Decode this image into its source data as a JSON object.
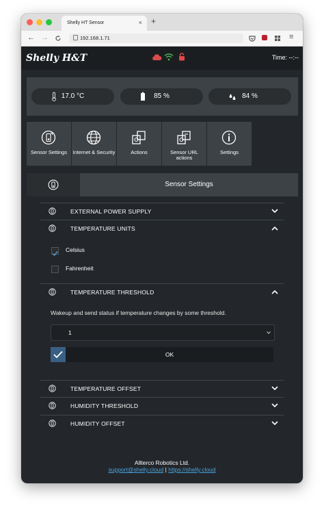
{
  "browser": {
    "tab_title": "Shelly HT Sensor",
    "tab_close": "×",
    "new_tab": "+",
    "back": "←",
    "forward": "→",
    "url": "192.168.1.71",
    "menu": "≡"
  },
  "header": {
    "logo": "Shelly H&T",
    "time_label": "Time: --:--",
    "status_icons": [
      "cloud-icon",
      "wifi-icon",
      "lock-icon"
    ],
    "colors": {
      "cloud": "#d94b4b",
      "wifi": "#4caf50",
      "lock": "#e04848"
    }
  },
  "stats": {
    "temperature": "17.0 °C",
    "battery": "85 %",
    "humidity": "84 %"
  },
  "tiles": [
    {
      "label": "Sensor Settings",
      "icon": "sensor-settings-icon"
    },
    {
      "label": "Internet & Security",
      "icon": "globe-icon"
    },
    {
      "label": "Actions",
      "icon": "actions-icon"
    },
    {
      "label": "Sensor URL actions",
      "icon": "url-actions-icon"
    },
    {
      "label": "Settings",
      "icon": "info-icon"
    }
  ],
  "section": {
    "title": "Sensor Settings"
  },
  "accordions": {
    "external_power": "EXTERNAL POWER SUPPLY",
    "temp_units": "TEMPERATURE UNITS",
    "temp_threshold": "TEMPERATURE THRESHOLD",
    "temp_offset": "TEMPERATURE OFFSET",
    "humidity_threshold": "HUMIDITY THRESHOLD",
    "humidity_offset": "HUMIDITY OFFSET"
  },
  "units": {
    "celsius": "Celsius",
    "celsius_checked": true,
    "fahrenheit": "Fahrenheit",
    "fahrenheit_checked": false
  },
  "threshold": {
    "description": "Wakeup and send status if temperature changes by some threshold.",
    "selected": "1",
    "ok": "OK"
  },
  "footer": {
    "company": "Allterco Robotics Ltd.",
    "email": "support@shelly.cloud",
    "separator": "|",
    "website": "https://shelly.cloud"
  }
}
